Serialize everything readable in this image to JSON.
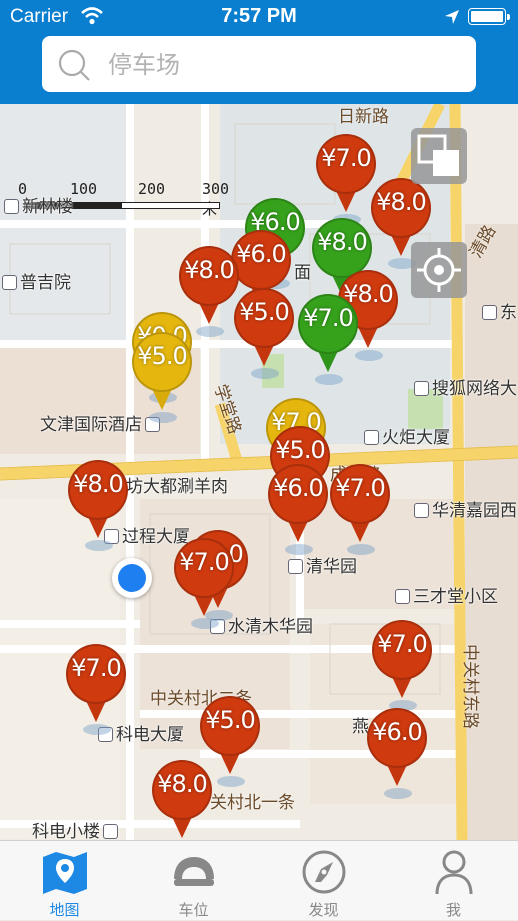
{
  "status_bar": {
    "carrier": "Carrier",
    "time": "7:57 PM"
  },
  "search": {
    "placeholder": "停车场",
    "value": ""
  },
  "map": {
    "scale": {
      "labels": [
        "0",
        "100",
        "200",
        "300 米"
      ]
    },
    "pois": [
      {
        "name": "新林楼"
      },
      {
        "name": "普吉院"
      },
      {
        "name": "文津国际酒店"
      },
      {
        "name": "火炬大厦"
      },
      {
        "name": "搜狐网络大"
      },
      {
        "name": "华清嘉园西"
      },
      {
        "name": "过程大厦"
      },
      {
        "name": "清华园"
      },
      {
        "name": "三才堂小区"
      },
      {
        "name": "水清木华园"
      },
      {
        "name": "科电大厦"
      },
      {
        "name": "科电小楼"
      },
      {
        "name": "燕"
      },
      {
        "name": "东"
      },
      {
        "name": "坊大都涮羊肉"
      },
      {
        "name": "面"
      }
    ],
    "roads": [
      {
        "name": "日新路"
      },
      {
        "name": "清路"
      },
      {
        "name": "学堂路"
      },
      {
        "name": "成府路"
      },
      {
        "name": "中关村北二条"
      },
      {
        "name": "关村北一条"
      },
      {
        "name": "中关村东路"
      }
    ],
    "parking_pins": [
      {
        "price": "¥7.0",
        "color": "red"
      },
      {
        "price": "¥8.0",
        "color": "red"
      },
      {
        "price": "¥6.0",
        "color": "green"
      },
      {
        "price": "¥8.0",
        "color": "green"
      },
      {
        "price": "¥6.0",
        "color": "red"
      },
      {
        "price": "¥8.0",
        "color": "red"
      },
      {
        "price": "¥8.0",
        "color": "red"
      },
      {
        "price": "¥0.0",
        "color": "yellow"
      },
      {
        "price": "¥5.0",
        "color": "yellow"
      },
      {
        "price": "¥5.0",
        "color": "red"
      },
      {
        "price": "¥7.0",
        "color": "green"
      },
      {
        "price": "¥7.0",
        "color": "yellow"
      },
      {
        "price": "¥5.0",
        "color": "red"
      },
      {
        "price": "¥8.0",
        "color": "red"
      },
      {
        "price": "¥6.0",
        "color": "red"
      },
      {
        "price": "¥7.0",
        "color": "red"
      },
      {
        "price": "¥7.0",
        "color": "red"
      },
      {
        "price": "¥7.0",
        "color": "red"
      },
      {
        "price": "¥7.0",
        "color": "red"
      },
      {
        "price": "¥5.0",
        "color": "red"
      },
      {
        "price": "¥7.0",
        "color": "red"
      },
      {
        "price": "¥6.0",
        "color": "red"
      },
      {
        "price": "¥8.0",
        "color": "red"
      }
    ],
    "colors": {
      "red": "#cf3a0f",
      "green": "#36a21c",
      "yellow": "#e5b70e",
      "accent": "#0a7fd0",
      "user": "#1e7ff0"
    }
  },
  "tabbar": {
    "items": [
      {
        "label": "地图",
        "icon": "map-icon",
        "active": true
      },
      {
        "label": "车位",
        "icon": "parking-spot-icon",
        "active": false
      },
      {
        "label": "发现",
        "icon": "compass-icon",
        "active": false
      },
      {
        "label": "我",
        "icon": "person-icon",
        "active": false
      }
    ]
  }
}
